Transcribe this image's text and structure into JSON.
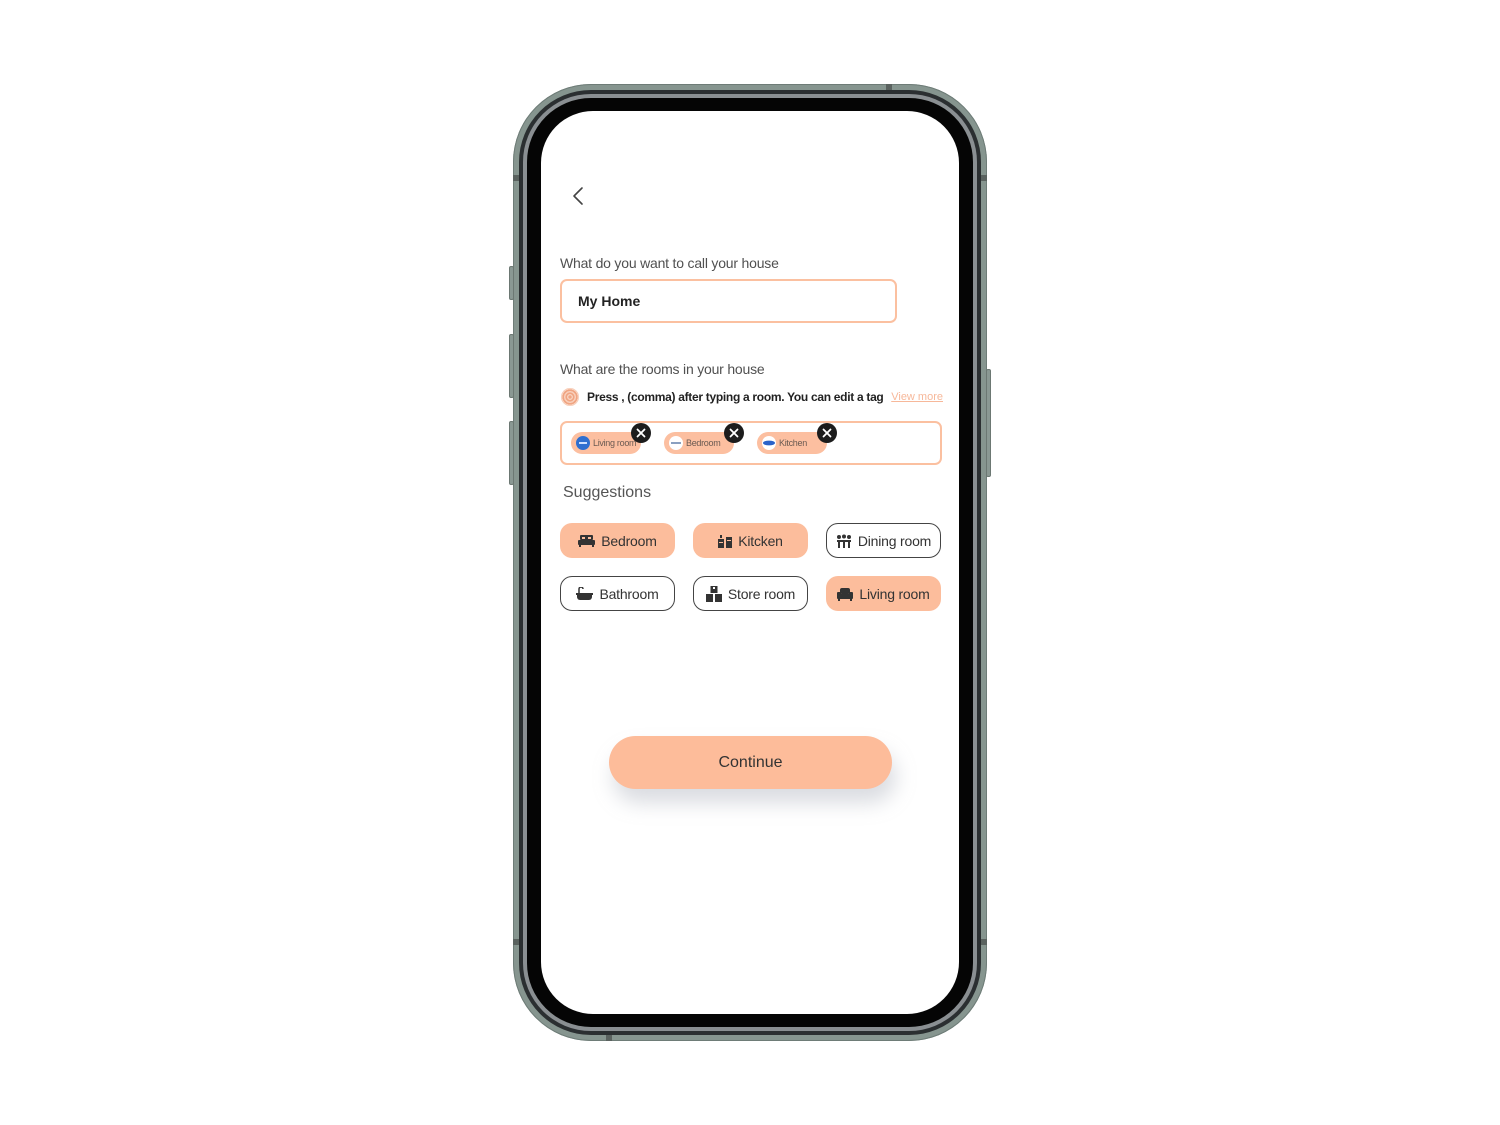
{
  "header": {
    "back_icon": "chevron-left-icon"
  },
  "house_name": {
    "label": "What do you want to call your house",
    "value": "My Home"
  },
  "rooms": {
    "label": "What are the rooms in your house",
    "hint_icon": "info-icon",
    "hint_text": "Press , (comma) after typing a room. You can edit a tag",
    "view_more_label": "View more",
    "tags": [
      {
        "label": "Living room",
        "thumb_icon": "living-room-thumbnail",
        "remove_icon": "close-icon"
      },
      {
        "label": "Bedroom",
        "thumb_icon": "bedroom-thumbnail",
        "remove_icon": "close-icon"
      },
      {
        "label": "Kitchen",
        "thumb_icon": "kitchen-thumbnail",
        "remove_icon": "close-icon"
      }
    ]
  },
  "suggestions": {
    "title": "Suggestions",
    "items": [
      {
        "label": "Bedroom",
        "icon": "bed-icon",
        "selected": true
      },
      {
        "label": "Kitcken",
        "icon": "kitchen-icon",
        "selected": true
      },
      {
        "label": "Dining room",
        "icon": "dining-icon",
        "selected": false
      },
      {
        "label": "Bathroom",
        "icon": "bathtub-icon",
        "selected": false
      },
      {
        "label": "Store room",
        "icon": "boxes-icon",
        "selected": false
      },
      {
        "label": "Living room",
        "icon": "sofa-icon",
        "selected": true
      }
    ]
  },
  "actions": {
    "continue_label": "Continue"
  },
  "colors": {
    "accent": "#fcbd9c",
    "accent_border": "#fbc0a0",
    "link": "#f7b89a",
    "frame": "#86958f"
  }
}
